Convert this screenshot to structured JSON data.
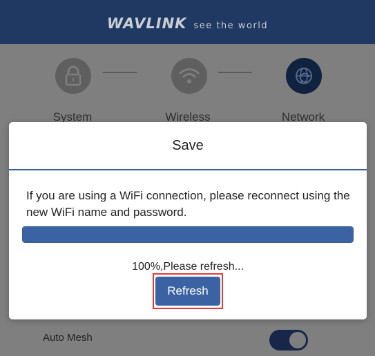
{
  "header": {
    "logo": "WAVLINK",
    "tagline": "see the world"
  },
  "steps": [
    {
      "label": "System",
      "icon": "lock-icon",
      "state": "inactive"
    },
    {
      "label": "Wireless",
      "icon": "wifi-icon",
      "state": "inactive"
    },
    {
      "label": "Network",
      "icon": "globe-refresh-icon",
      "state": "active"
    }
  ],
  "settings": {
    "auto_mesh_label": "Auto Mesh",
    "auto_mesh_enabled": true
  },
  "modal": {
    "title": "Save",
    "message": "If you are using a WiFi connection, please reconnect using the new WiFi name and password.",
    "progress_percent": 100,
    "progress_text": "100%,Please refresh...",
    "refresh_label": "Refresh"
  },
  "colors": {
    "header_bg": "#1f3962",
    "accent": "#3b63a3",
    "highlight": "#e53935",
    "overlay": "#7f7f7f"
  }
}
